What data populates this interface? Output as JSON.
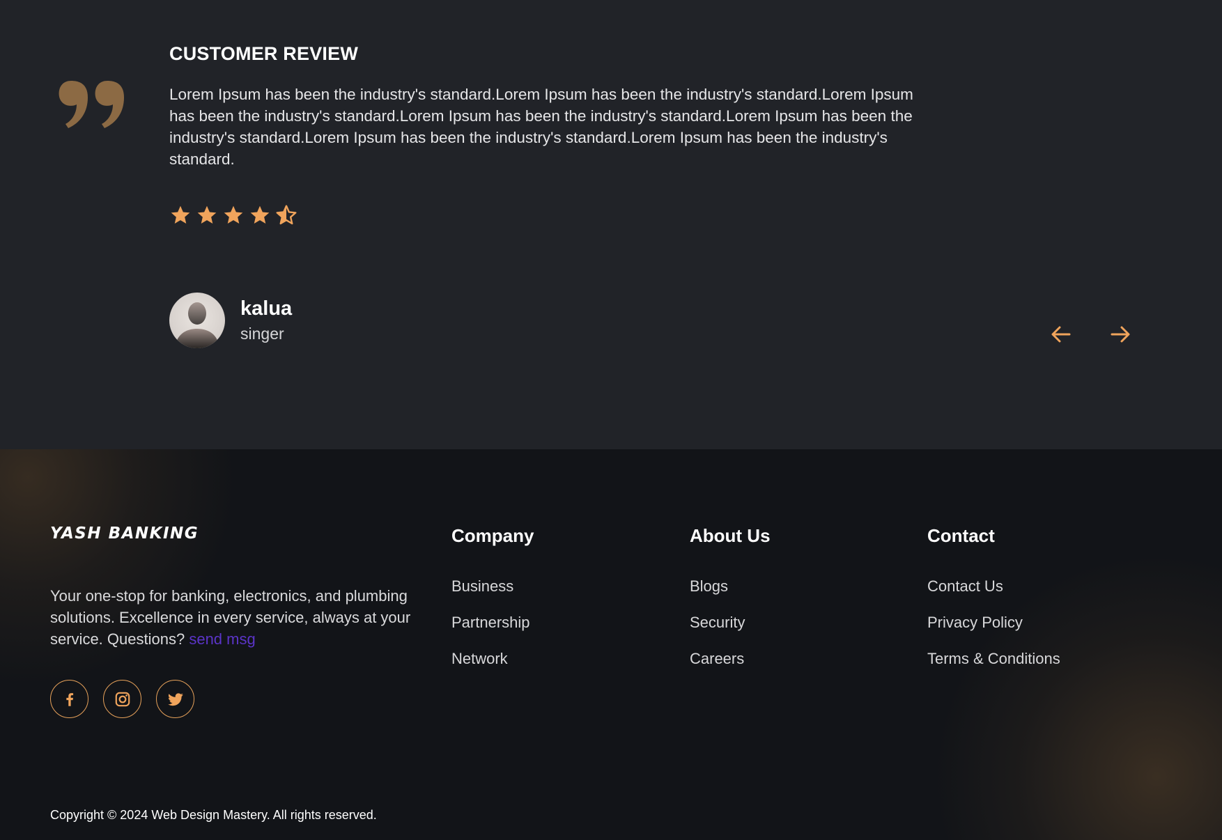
{
  "review": {
    "title": "CUSTOMER REVIEW",
    "text": "Lorem Ipsum has been the industry's standard.Lorem Ipsum has been the industry's standard.Lorem Ipsum has been the industry's standard.Lorem Ipsum has been the industry's standard.Lorem Ipsum has been the industry's standard.Lorem Ipsum has been the industry's standard.Lorem Ipsum has been the industry's standard.",
    "rating": 4.5,
    "rating_max": 5,
    "author_name": "kalua",
    "author_role": "singer",
    "prev_icon": "arrow-left-icon",
    "next_icon": "arrow-right-icon"
  },
  "footer": {
    "brand": "YASH BANKING",
    "description": "Your one-stop for banking, electronics, and plumbing solutions. Excellence in every service, always at your service. Questions?",
    "send_link": "send msg",
    "socials": [
      "facebook-icon",
      "instagram-icon",
      "twitter-icon"
    ],
    "columns": {
      "company": {
        "title": "Company",
        "links": [
          "Business",
          "Partnership",
          "Network"
        ]
      },
      "about": {
        "title": "About Us",
        "links": [
          "Blogs",
          "Security",
          "Careers"
        ]
      },
      "contact": {
        "title": "Contact",
        "links": [
          "Contact Us",
          "Privacy Policy",
          "Terms & Conditions"
        ]
      }
    },
    "copyright": "Copyright © 2024 Web Design Mastery. All rights reserved."
  },
  "colors": {
    "accent": "#f0a45c",
    "quote": "#8c6a44",
    "link": "#5b34c8",
    "review_bg": "#212328",
    "footer_bg": "#121418"
  }
}
